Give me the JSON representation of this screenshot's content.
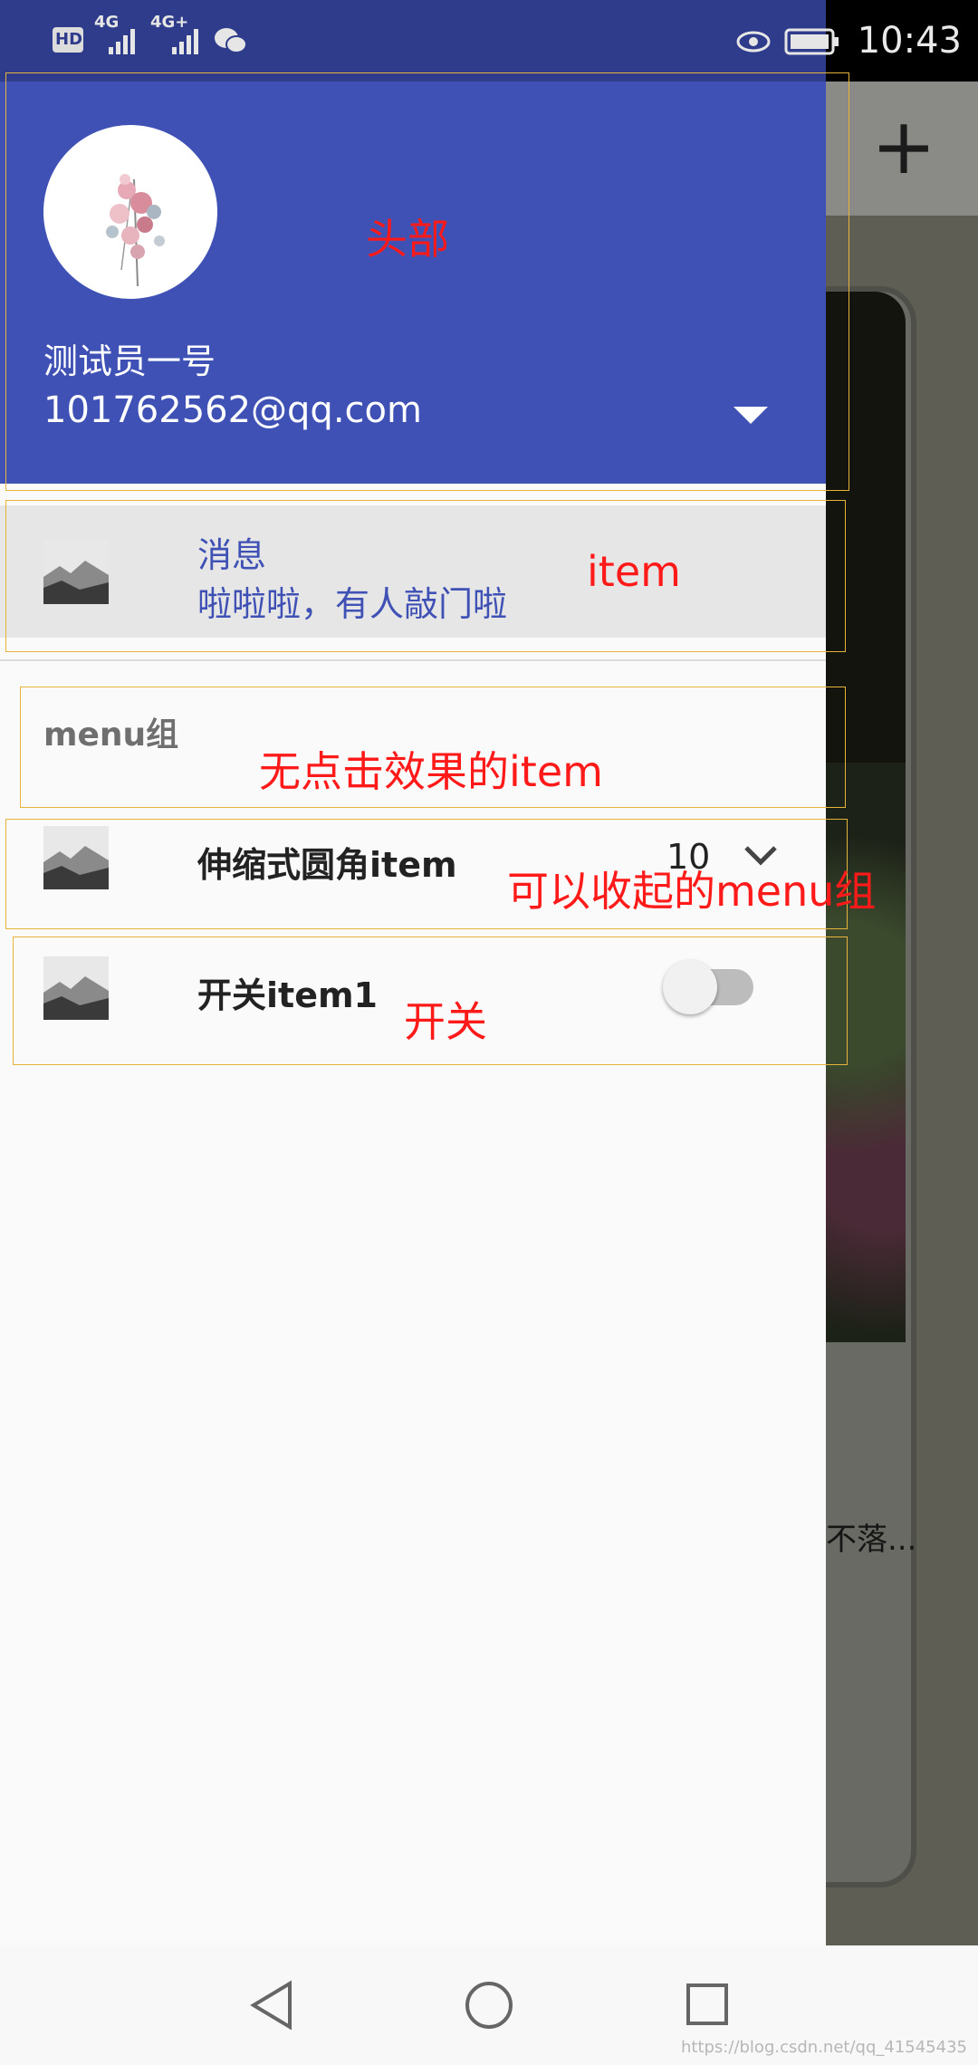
{
  "status_bar": {
    "hd_badge": "HD",
    "network1": "4G",
    "network2": "4G+",
    "time": "10:43"
  },
  "drawer_header": {
    "user_name": "测试员一号",
    "user_email": "101762562@qq.com"
  },
  "nav_item_message": {
    "title": "消息",
    "subtitle": "啦啦啦，有人敲门啦"
  },
  "menu_group": {
    "title": "menu组",
    "expandable_item": {
      "label": "伸缩式圆角item",
      "count": "10"
    },
    "switch_item": {
      "label": "开关item1",
      "state": "off"
    }
  },
  "annotations": {
    "header": "头部",
    "item": "item",
    "non_click_item": "无点击效果的item",
    "collapsible_group": "可以收起的menu组",
    "switch": "开关"
  },
  "background_screen": {
    "snippet_text": "不落..."
  },
  "watermark": "https://blog.csdn.net/qq_41545435",
  "colors": {
    "accent": "#3f51b5",
    "annotation": "#ff1a1a",
    "annotation_box": "#e6b43b"
  }
}
